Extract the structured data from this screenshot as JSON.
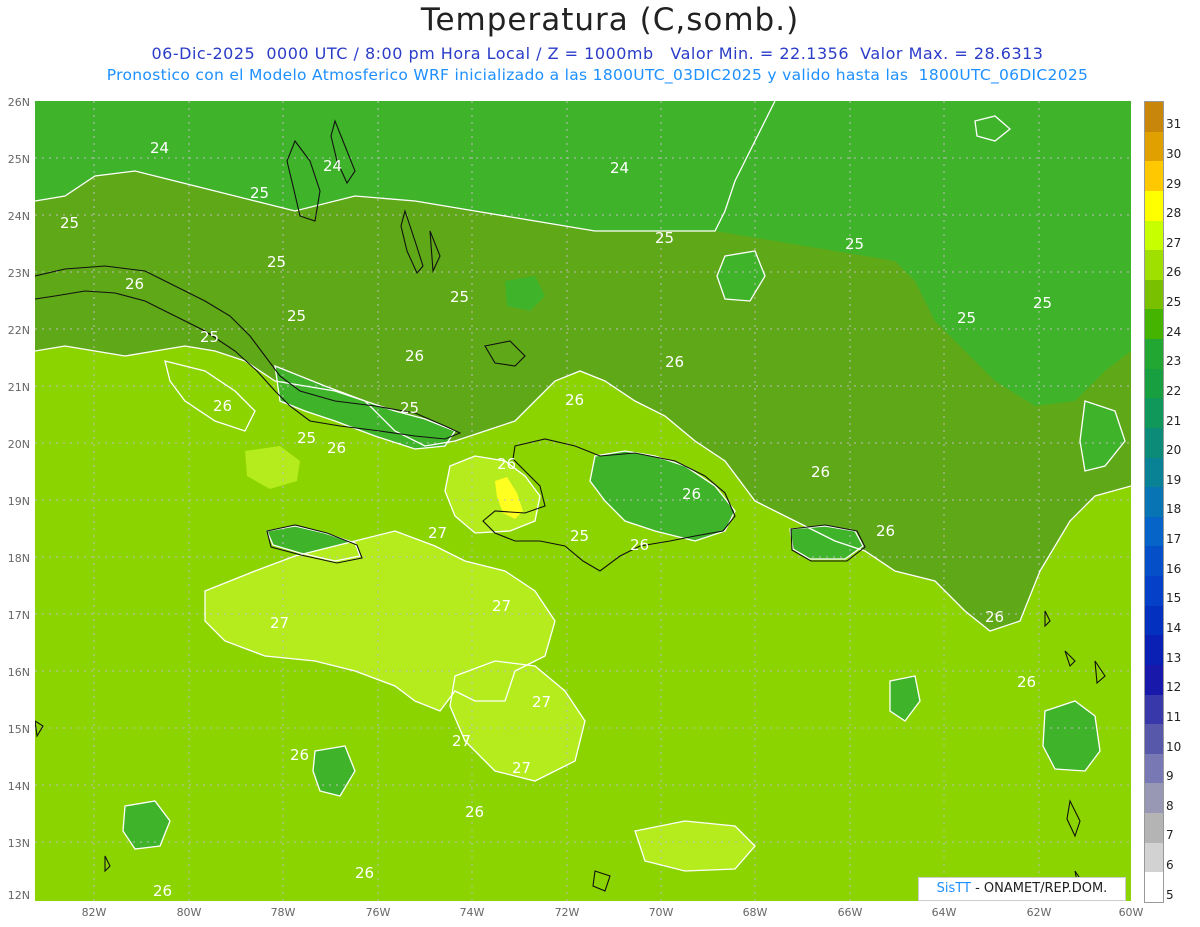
{
  "title": "Temperatura (C,somb.)",
  "subtitle_line1": "06-Dic-2025  0000 UTC / 8:00 pm Hora Local / Z = 1000mb   Valor Min. = 22.1356  Valor Max. = 28.6313",
  "subtitle_line2": "Pronostico con el Modelo Atmosferico WRF inicializado a las 1800UTC_03DIC2025 y valido hasta las  1800UTC_06DIC2025",
  "credit": {
    "brand": "SisTT",
    "text": " - ONAMET/REP.DOM."
  },
  "lat_labels": [
    "26N",
    "25N",
    "24N",
    "23N",
    "22N",
    "21N",
    "20N",
    "19N",
    "18N",
    "17N",
    "16N",
    "15N",
    "14N",
    "13N",
    "12N"
  ],
  "lon_labels": [
    "82W",
    "80W",
    "78W",
    "76W",
    "74W",
    "72W",
    "70W",
    "68W",
    "66W",
    "64W",
    "62W",
    "60W"
  ],
  "colorbar": {
    "labels": [
      "31",
      "30",
      "29",
      "28",
      "27",
      "26",
      "25",
      "24",
      "23",
      "22",
      "21",
      "20",
      "19",
      "18",
      "17",
      "16",
      "15",
      "14",
      "13",
      "12",
      "11",
      "10",
      "9",
      "8",
      "7",
      "6",
      "5"
    ],
    "colors": [
      "#c8860a",
      "#e0a000",
      "#ffc800",
      "#ffff00",
      "#c8ff00",
      "#a0e000",
      "#78c000",
      "#44b400",
      "#22a832",
      "#18a040",
      "#10985a",
      "#0c8c78",
      "#0a8296",
      "#0874b4",
      "#0664c8",
      "#0550c8",
      "#0440c8",
      "#0430c0",
      "#0a20b4",
      "#1818aa",
      "#3838aa",
      "#5858aa",
      "#7878b4",
      "#9898b4",
      "#b4b4b4",
      "#d2d2d2",
      "#ffffff"
    ]
  },
  "contour_labels": [
    {
      "text": "24"
    },
    {
      "text": "24"
    },
    {
      "text": "24"
    },
    {
      "text": "25"
    },
    {
      "text": "25"
    },
    {
      "text": "25"
    },
    {
      "text": "25"
    },
    {
      "text": "25"
    },
    {
      "text": "25"
    },
    {
      "text": "25"
    },
    {
      "text": "25"
    },
    {
      "text": "25"
    },
    {
      "text": "25"
    },
    {
      "text": "25"
    },
    {
      "text": "25"
    },
    {
      "text": "26"
    },
    {
      "text": "26"
    },
    {
      "text": "26"
    },
    {
      "text": "26"
    },
    {
      "text": "26"
    },
    {
      "text": "26"
    },
    {
      "text": "26"
    },
    {
      "text": "26"
    },
    {
      "text": "26"
    },
    {
      "text": "26"
    },
    {
      "text": "26"
    },
    {
      "text": "26"
    },
    {
      "text": "26"
    },
    {
      "text": "26"
    },
    {
      "text": "26"
    },
    {
      "text": "26"
    },
    {
      "text": "27"
    },
    {
      "text": "27"
    },
    {
      "text": "27"
    },
    {
      "text": "27"
    },
    {
      "text": "27"
    },
    {
      "text": "27"
    },
    {
      "text": "25"
    },
    {
      "text": "26"
    }
  ],
  "colors": {
    "field_24": "#3fb42a",
    "field_25": "#5fa818",
    "field_26": "#8cd400",
    "field_27": "#b4ec1e",
    "field_28": "#ffff20",
    "contour": "#ffffff",
    "coast": "#111111",
    "grid": "#bdbdbd"
  }
}
